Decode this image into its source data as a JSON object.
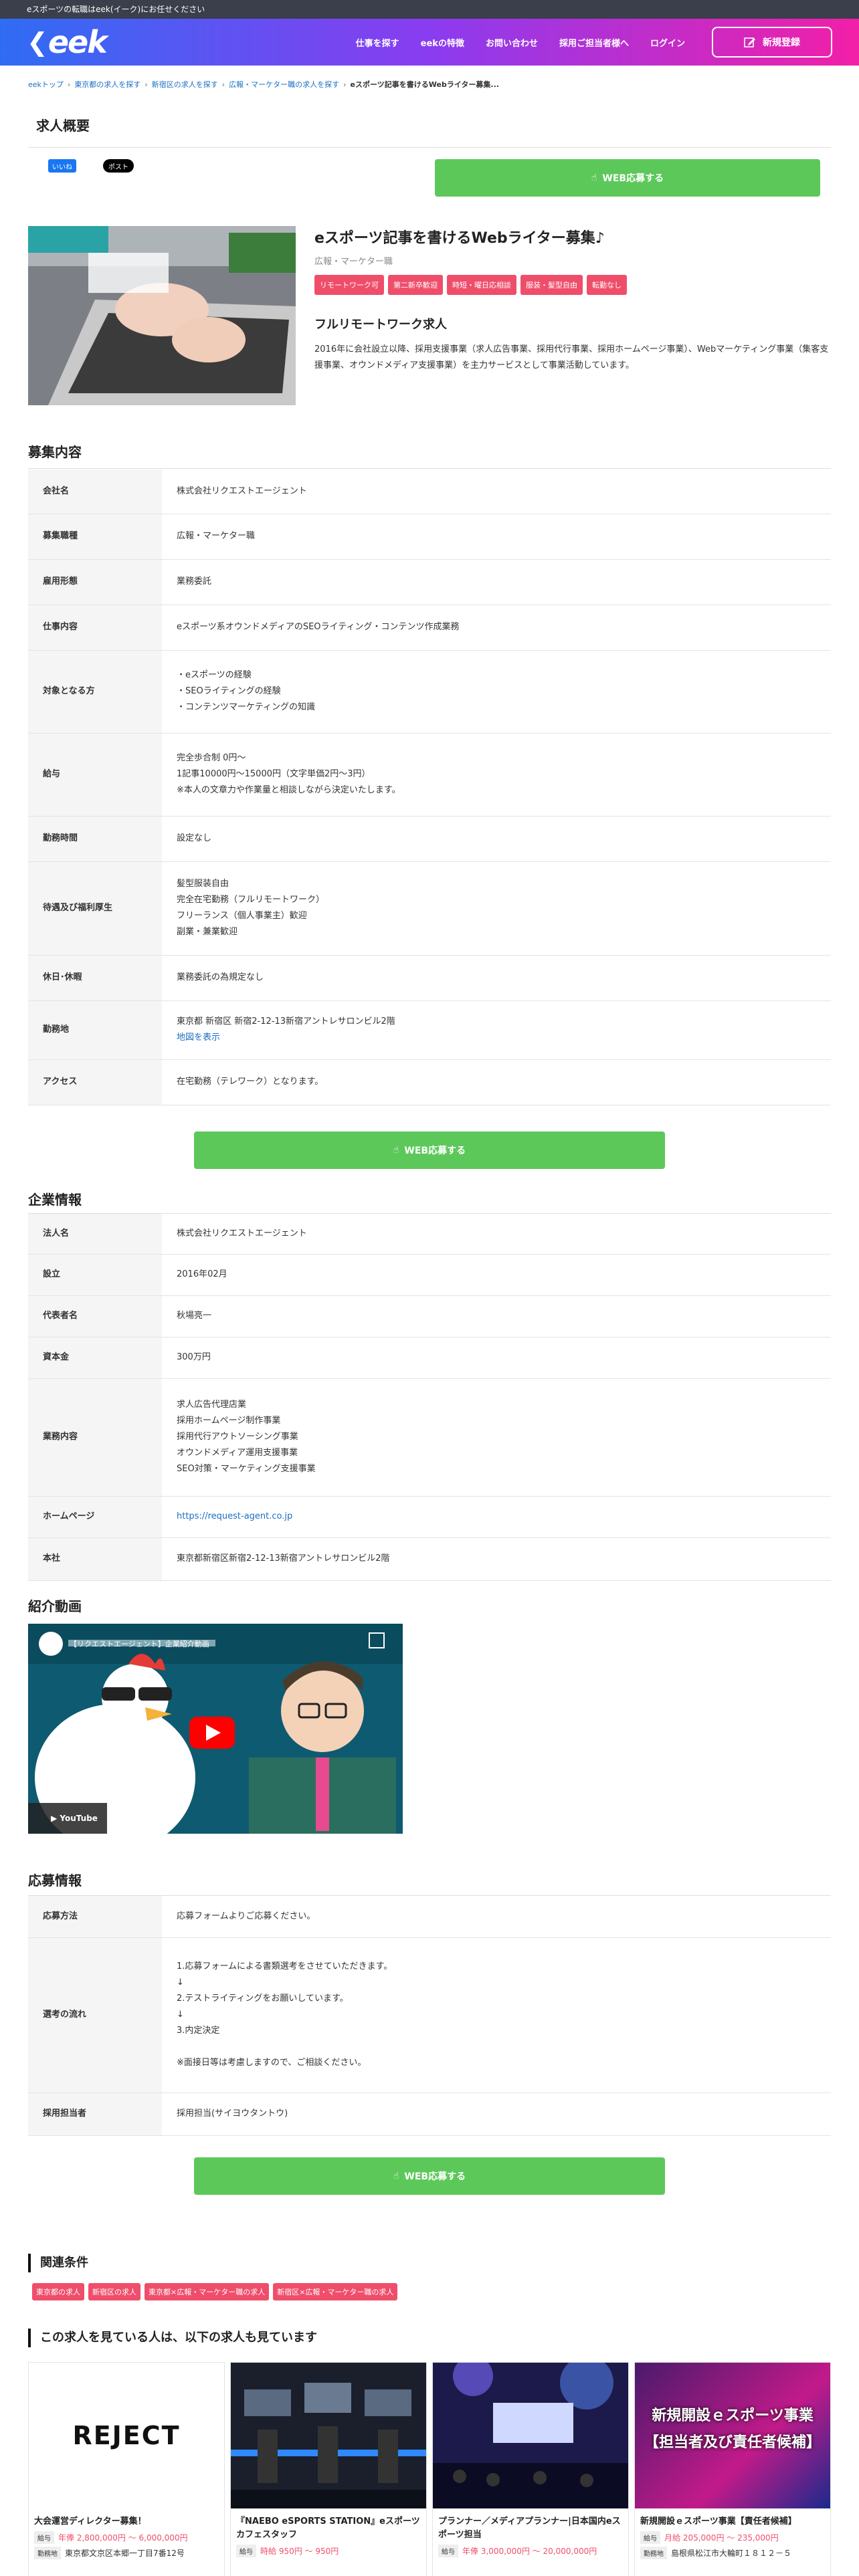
{
  "topbar": {
    "notice": "eスポーツの転職はeek(イーク)にお任せください"
  },
  "header": {
    "logo_text": "eek",
    "nav": [
      "仕事を探す",
      "eekの特徴",
      "お問い合わせ",
      "採用ご担当者様へ",
      "ログイン"
    ],
    "signup_label": "新規登録"
  },
  "breadcrumb": [
    "eekトップ",
    "東京都の求人を探す",
    "新宿区の求人を探す",
    "広報・マーケター職の求人を探す",
    "eスポーツ記事を書けるWebライター募集..."
  ],
  "overview": {
    "title": "求人概要",
    "fb_label": "いいね",
    "x_label": "ポスト",
    "apply_label": "WEB応募する"
  },
  "job": {
    "title": "eスポーツ記事を書けるWebライター募集♪",
    "category": "広報・マーケター職",
    "tags": [
      "リモートワーク可",
      "第二新卒歓迎",
      "時短・曜日応相談",
      "服装・髪型自由",
      "転勤なし"
    ],
    "remote_heading": "フルリモートワーク求人",
    "description": "2016年に会社設立以降、採用支援事業（求人広告事業、採用代行事業、採用ホームページ事業）、Webマーケティング事業（集客支援事業、オウンドメディア支援事業）を主力サービスとして事業活動しています。"
  },
  "recruit": {
    "title": "募集内容",
    "rows": [
      {
        "k": "会社名",
        "v": [
          "株式会社リクエストエージェント"
        ]
      },
      {
        "k": "募集職種",
        "v": [
          "広報・マーケター職"
        ]
      },
      {
        "k": "雇用形態",
        "v": [
          "業務委託"
        ]
      },
      {
        "k": "仕事内容",
        "v": [
          "eスポーツ系オウンドメディアのSEOライティング・コンテンツ作成業務"
        ]
      },
      {
        "k": "対象となる方",
        "v": [
          "・eスポーツの経験",
          "・SEOライティングの経験",
          "・コンテンツマーケティングの知識"
        ]
      },
      {
        "k": "給与",
        "v": [
          "完全歩合制 0円〜",
          "1記事10000円〜15000円（文字単価2円〜3円）",
          "※本人の文章力や作業量と相談しながら決定いたします。"
        ]
      },
      {
        "k": "勤務時間",
        "v": [
          "設定なし"
        ]
      },
      {
        "k": "待遇及び福利厚生",
        "v": [
          "髪型服装自由",
          "完全在宅勤務（フルリモートワーク）",
          "フリーランス（個人事業主）歓迎",
          "副業・兼業歓迎"
        ]
      },
      {
        "k": "休日･休暇",
        "v": [
          "業務委託の為規定なし"
        ]
      },
      {
        "k": "勤務地",
        "v": [
          "東京都 新宿区 新宿2-12-13新宿アントレサロンビル2階"
        ],
        "link": "地図を表示"
      },
      {
        "k": "アクセス",
        "v": [
          "在宅勤務（テレワーク）となります。"
        ]
      }
    ],
    "apply_label": "WEB応募する"
  },
  "company": {
    "title": "企業情報",
    "rows": [
      {
        "k": "法人名",
        "v": [
          "株式会社リクエストエージェント"
        ]
      },
      {
        "k": "設立",
        "v": [
          "2016年02月"
        ]
      },
      {
        "k": "代表者名",
        "v": [
          "秋場亮一"
        ]
      },
      {
        "k": "資本金",
        "v": [
          "300万円"
        ]
      },
      {
        "k": "業務内容",
        "v": [
          "求人広告代理店業",
          "採用ホームページ制作事業",
          "採用代行アウトソーシング事業",
          "オウンドメディア運用支援事業",
          "SEO対策・マーケティング支援事業"
        ]
      },
      {
        "k": "ホームページ",
        "v": [],
        "link": "https://request-agent.co.jp"
      },
      {
        "k": "本社",
        "v": [
          "東京都新宿区新宿2-12-13新宿アントレサロンビル2階"
        ]
      }
    ]
  },
  "video": {
    "title": "紹介動画",
    "caption": "【リクエストエージェント】企業紹介動画",
    "yt_label": "YouTube"
  },
  "apply": {
    "title": "応募情報",
    "rows": [
      {
        "k": "応募方法",
        "v": [
          "応募フォームよりご応募ください。"
        ]
      },
      {
        "k": "選考の流れ",
        "v": [
          "1.応募フォームによる書類選考をさせていただきます。",
          "↓",
          "2.テストライティングをお願いしています。",
          "↓",
          "3.内定決定",
          "",
          "※面接日等は考慮しますので、ご相談ください。"
        ]
      },
      {
        "k": "採用担当者",
        "v": [
          "採用担当(サイヨウタントウ)"
        ]
      }
    ],
    "apply_label": "WEB応募する"
  },
  "related": {
    "title": "関連条件",
    "tags": [
      "東京都の求人",
      "新宿区の求人",
      "東京都×広報・マーケター職の求人",
      "新宿区×広報・マーケター職の求人"
    ]
  },
  "others": {
    "title": "この求人を見ている人は、以下の求人も見ています",
    "cards": [
      {
        "img_text": "REJECT",
        "title": "大会運営ディレクター募集！",
        "salary_label": "給与",
        "salary": "年俸 2,800,000円 〜 6,000,000円",
        "loc_label": "勤務地",
        "loc": "東京都文京区本郷一丁目7番12号"
      },
      {
        "img_text": "",
        "title": "『NAEBO eSPORTS STATION』eスポーツカフェスタッフ",
        "salary_label": "給与",
        "salary": "時給 950円 〜 950円",
        "loc_label": "",
        "loc": ""
      },
      {
        "img_text": "",
        "title": "プランナー／メディアプランナー|日本国内eスポーツ担当",
        "salary_label": "給与",
        "salary": "年俸 3,000,000円 〜 20,000,000円",
        "loc_label": "",
        "loc": ""
      },
      {
        "img_text": "新規開設ｅスポーツ事業【担当者及び責任者候補】",
        "title": "新規開設ｅスポーツ事業【責任者候補】",
        "salary_label": "給与",
        "salary": "月給 205,000円 〜 235,000円",
        "loc_label": "勤務地",
        "loc": "島根県松江市大輪町１８１２－５"
      }
    ]
  }
}
